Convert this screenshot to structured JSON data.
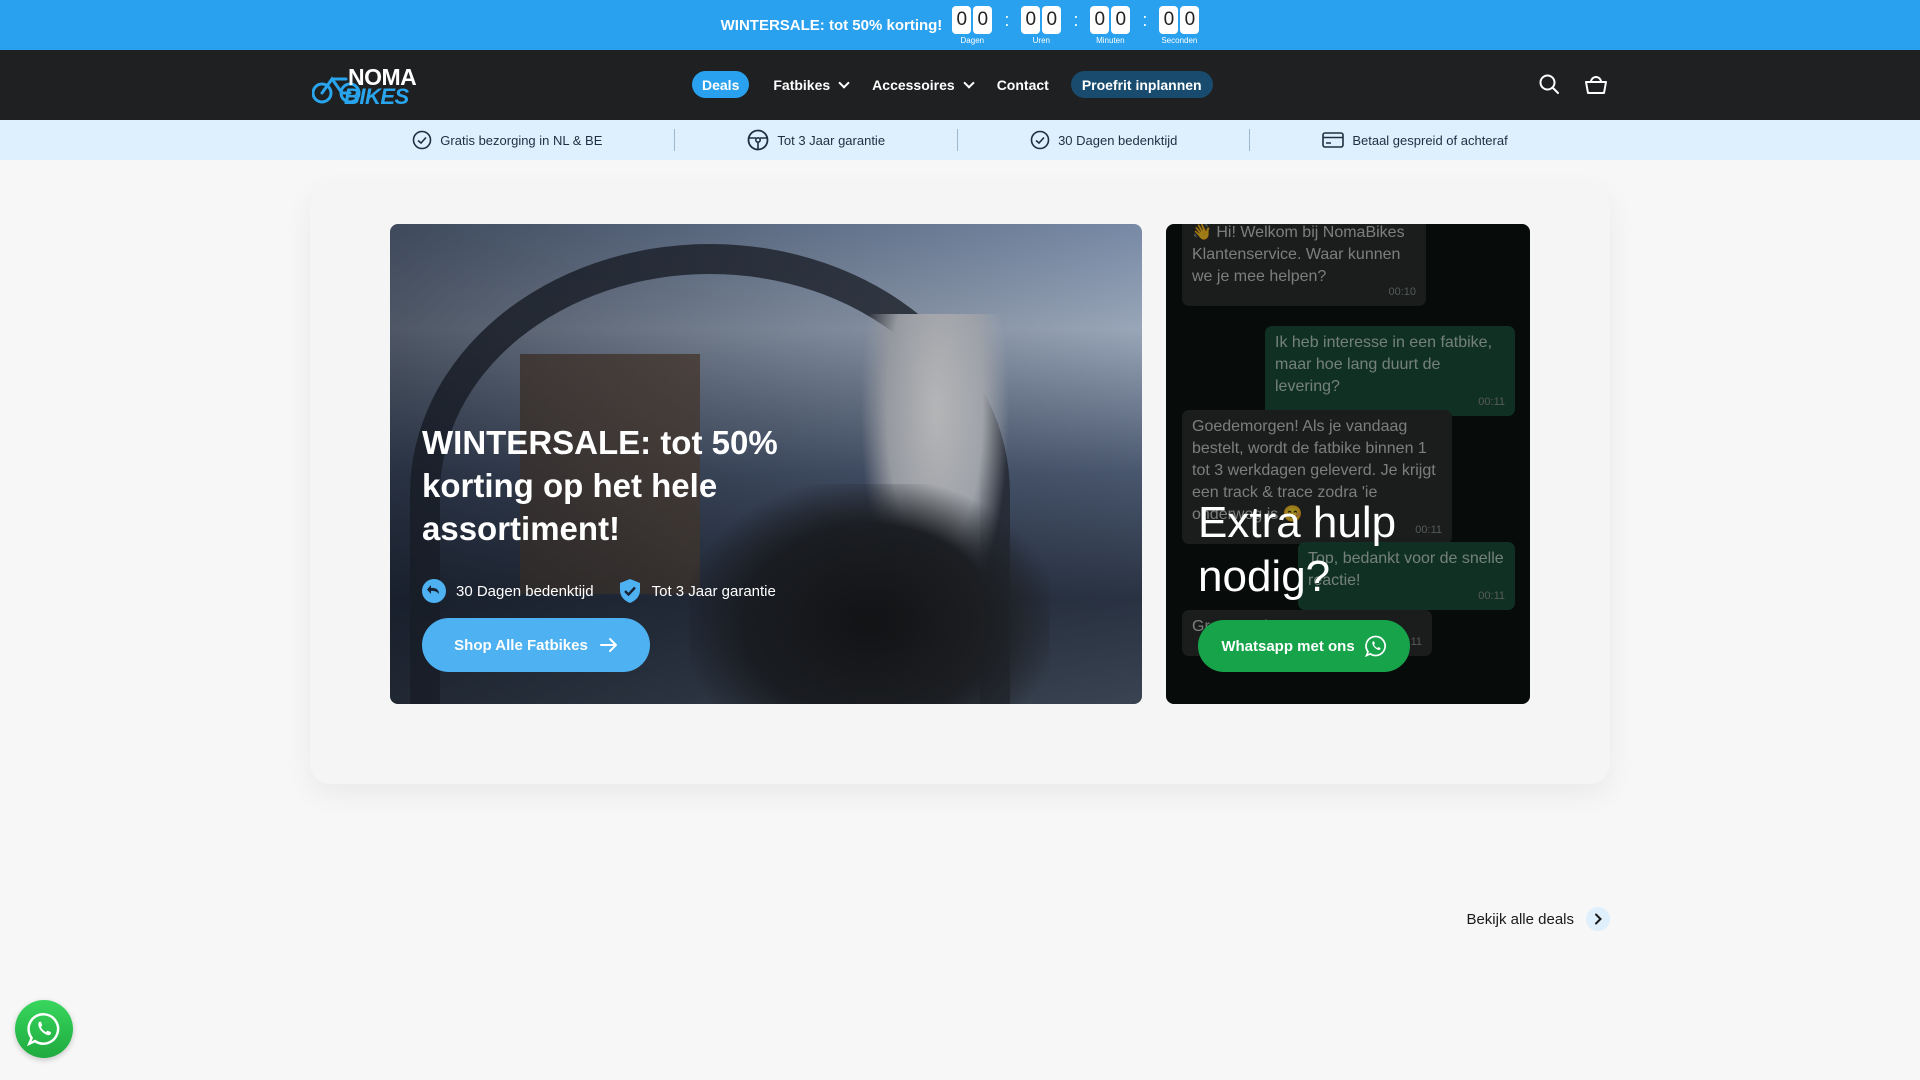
{
  "announcement": {
    "text": "WINTERSALE: tot 50% korting!",
    "countdown": [
      {
        "digits": [
          "0",
          "0"
        ],
        "label": "Dagen"
      },
      {
        "digits": [
          "0",
          "0"
        ],
        "label": "Uren"
      },
      {
        "digits": [
          "0",
          "0"
        ],
        "label": "Minuten"
      },
      {
        "digits": [
          "0",
          "0"
        ],
        "label": "Seconden"
      }
    ],
    "separator": ":"
  },
  "logo": {
    "line1": "NOMA",
    "line2": "BIKES"
  },
  "nav": {
    "deals": "Deals",
    "fatbikes": "Fatbikes",
    "accessoires": "Accessoires",
    "contact": "Contact",
    "proefrit": "Proefrit inplannen"
  },
  "usp": [
    {
      "icon": "check-circle-icon",
      "label": "Gratis bezorging in NL & BE"
    },
    {
      "icon": "steering-wheel-icon",
      "label": "Tot 3 Jaar garantie"
    },
    {
      "icon": "check-circle-icon",
      "label": "30 Dagen bedenktijd"
    },
    {
      "icon": "credit-card-icon",
      "label": "Betaal gespreid of achteraf"
    }
  ],
  "hero": {
    "title": "WINTERSALE: tot 50% korting op het hele assortiment!",
    "badge1": "30 Dagen bedenktijd",
    "badge2": "Tot 3 Jaar garantie",
    "button": "Shop Alle Fatbikes"
  },
  "help": {
    "chats": [
      {
        "text": "👋 Hi! Welkom bij NomaBikes Klantenservice. Waar kunnen we je mee helpen?",
        "time": "00:10"
      },
      {
        "text": "Ik heb interesse in een fatbike, maar hoe lang duurt de levering?",
        "time": "00:11"
      },
      {
        "text": "Goedemorgen! Als je vandaag bestelt, wordt de fatbike binnen 1 tot 3 werkdagen geleverd. Je krijgt een track & trace zodra 'ie onderweg is 😊",
        "time": "00:11"
      },
      {
        "text": "Top, bedankt voor de snelle reactie!",
        "time": "00:11"
      },
      {
        "text": "Graag gedaan! ...",
        "time": "00:11"
      }
    ],
    "title": "Extra hulp nodig?",
    "button": "Whatsapp met ons"
  },
  "deals_link": "Bekijk alle deals",
  "colors": {
    "accent": "#2aa1ee",
    "header": "#1f2021",
    "whatsapp": "#17a34a"
  }
}
